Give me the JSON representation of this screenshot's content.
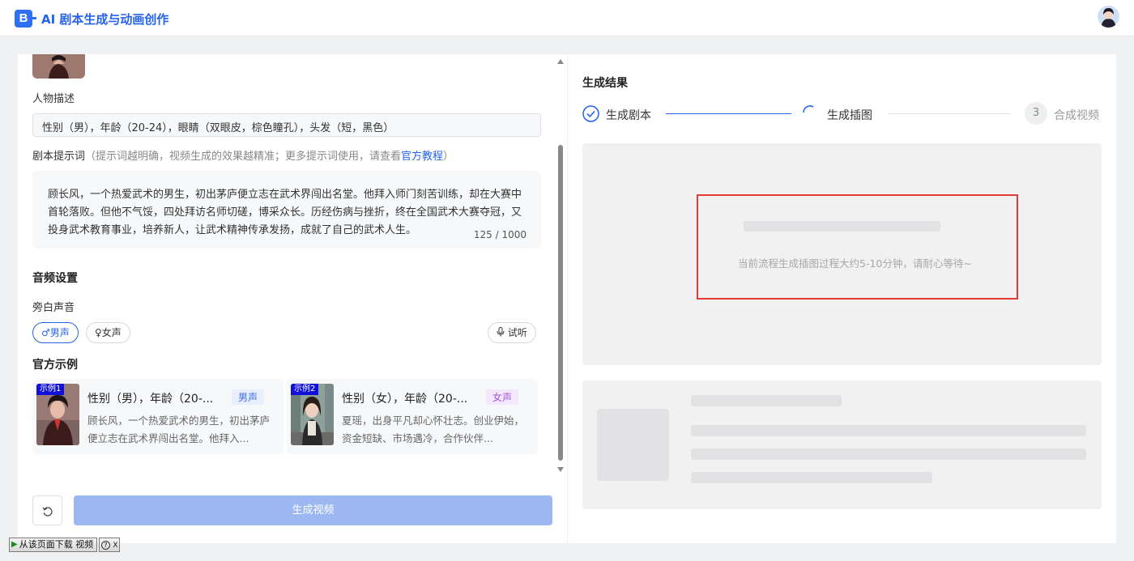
{
  "header": {
    "logo_letter": "B",
    "app_title": "AI 剧本生成与动画创作"
  },
  "character": {
    "desc_label": "人物描述",
    "desc_value": "性别（男），年龄（20-24），眼睛（双眼皮，棕色瞳孔），头发（短，黑色）"
  },
  "prompt": {
    "label": "剧本提示词",
    "hint": "（提示词越明确，视频生成的效果越精准；更多提示词使用，请查看",
    "link": "官方教程",
    "hint_end": "）",
    "text": "顾长风，一个热爱武术的男生，初出茅庐便立志在武术界闯出名堂。他拜入师门刻苦训练，却在大赛中首轮落败。但他不气馁，四处拜访名师切磋，博采众长。历经伤病与挫折，终在全国武术大赛夺冠，又投身武术教育事业，培养新人，让武术精神传承发扬，成就了自己的武术人生。",
    "counter": "125 / 1000"
  },
  "audio": {
    "title": "音频设置",
    "narration_label": "旁白声音",
    "male_label": "男声",
    "female_label": "女声",
    "preview_label": "试听",
    "selected": "男声"
  },
  "examples": {
    "title": "官方示例",
    "items": [
      {
        "badge": "示例1",
        "title": "性别（男），年龄（20-...",
        "tag": "男声",
        "text": "顾长风，一个热爱武术的男生，初出茅庐便立志在武术界闯出名堂。他拜入..."
      },
      {
        "badge": "示例2",
        "title": "性别（女），年龄（20-...",
        "tag": "女声",
        "text": "夏瑶，出身平凡却心怀壮志。创业伊始，资金短缺、市场遇冷，合作伙伴..."
      }
    ]
  },
  "actions": {
    "generate_label": "生成视频"
  },
  "result": {
    "title": "生成结果",
    "steps": [
      {
        "label": "生成剧本",
        "state": "done"
      },
      {
        "label": "生成插图",
        "state": "loading"
      },
      {
        "label": "合成视频",
        "number": "3",
        "state": "pending"
      }
    ],
    "wait_text": "当前流程生成插图过程大约5-10分钟，请耐心等待~"
  },
  "download_bar": {
    "label": "从该页面下载 视频",
    "help": "?",
    "close": "X"
  },
  "colors": {
    "accent": "#2563eb",
    "button_disabled": "#9db7f3",
    "highlight_frame": "#e53935"
  }
}
